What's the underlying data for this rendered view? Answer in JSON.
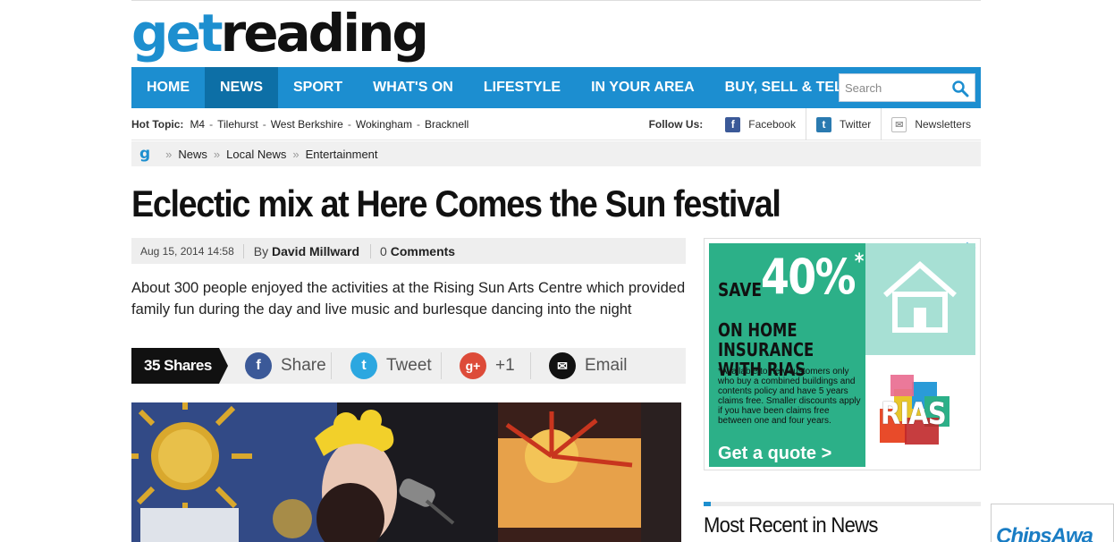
{
  "logo": {
    "part1": "get",
    "part2": "reading"
  },
  "nav": {
    "items": [
      {
        "label": "HOME"
      },
      {
        "label": "NEWS",
        "active": true
      },
      {
        "label": "SPORT"
      },
      {
        "label": "WHAT'S ON"
      },
      {
        "label": "LIFESTYLE"
      },
      {
        "label": "IN YOUR AREA"
      },
      {
        "label": "BUY, SELL & TELL"
      }
    ],
    "search_placeholder": "Search",
    "color": "#1c8ed0",
    "active_color": "#0d6fa6"
  },
  "hot_topics": {
    "label": "Hot Topic:",
    "links": [
      "M4",
      "Tilehurst",
      "West Berkshire",
      "Wokingham",
      "Bracknell"
    ],
    "separator": "-"
  },
  "follow": {
    "label": "Follow Us:",
    "items": [
      {
        "label": "Facebook",
        "icon": "facebook-icon",
        "color": "#3b5998"
      },
      {
        "label": "Twitter",
        "icon": "twitter-icon",
        "color": "#2a7ab0"
      },
      {
        "label": "Newsletters",
        "icon": "mail-icon",
        "color": "#bbbbbb"
      }
    ]
  },
  "breadcrumb": {
    "home_glyph": "g",
    "separator": "»",
    "items": [
      "News",
      "Local News",
      "Entertainment"
    ]
  },
  "article": {
    "headline": "Eclectic mix at Here Comes the Sun festival",
    "date": "Aug 15, 2014 14:58",
    "by_label": "By",
    "author": "David Millward",
    "comments_count": "0",
    "comments_label": "Comments",
    "standfirst": "About 300 people enjoyed the activities at the Rising Sun Arts Centre which provided family fun during the day and live music and burlesque dancing into the night"
  },
  "share": {
    "count_label": "35 Shares",
    "buttons": [
      {
        "label": "Share",
        "icon": "facebook-icon",
        "glyph": "f",
        "color": "#3b5998"
      },
      {
        "label": "Tweet",
        "icon": "twitter-icon",
        "glyph": "t",
        "color": "#2ca7e0"
      },
      {
        "label": "+1",
        "icon": "google-plus-icon",
        "glyph": "g+",
        "color": "#dd4b39"
      },
      {
        "label": "Email",
        "icon": "email-icon",
        "glyph": "✉",
        "color": "#111111"
      }
    ]
  },
  "ad": {
    "save": "SAVE",
    "percent": "40%",
    "asterisk": "*",
    "headline_line1": "ON HOME INSURANCE",
    "headline_line2": "WITH RIAS",
    "small_print": "*Available to new customers only who buy a combined buildings and contents policy and have 5 years claims free. Smaller discounts apply if you have been claims free between one and four years.",
    "cta": "Get a quote >",
    "brand": "RIAS",
    "green": "#2cb088",
    "mint": "#a7e0d4"
  },
  "recent": {
    "title": "Most Recent in News",
    "accent": "#1d8fcf"
  },
  "side_ad": {
    "text": "ChipsAwa"
  }
}
